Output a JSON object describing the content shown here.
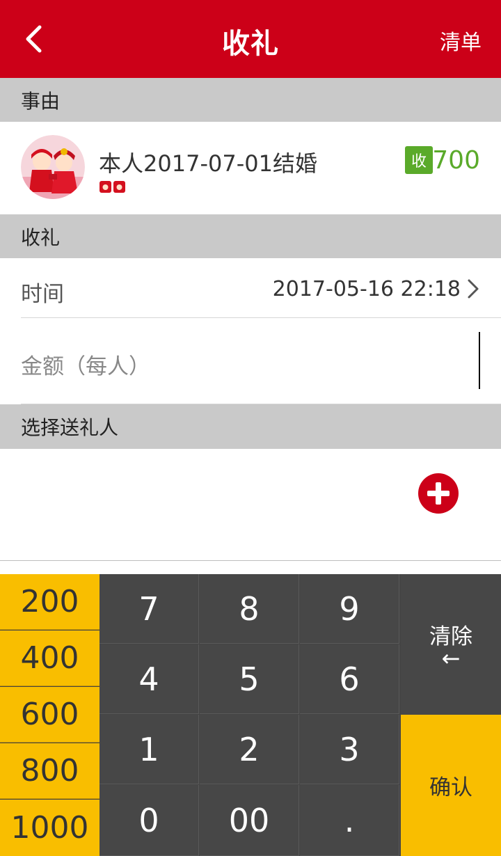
{
  "header": {
    "title": "收礼",
    "right_label": "清单",
    "back_icon": "chevron-left-icon"
  },
  "sections": {
    "reason": "事由",
    "receive": "收礼",
    "choose_giver": "选择送礼人"
  },
  "event": {
    "title": "本人2017-07-01结婚",
    "badge": "收",
    "amount": "700",
    "avatar_icon": "wedding-couple-avatar"
  },
  "form": {
    "time_label": "时间",
    "time_value": "2017-05-16 22:18",
    "amount_placeholder": "金额（每人）"
  },
  "keypad": {
    "presets": [
      "200",
      "400",
      "600",
      "800",
      "1000"
    ],
    "digits": [
      "7",
      "8",
      "9",
      "4",
      "5",
      "6",
      "1",
      "2",
      "3",
      "0",
      "00",
      "."
    ],
    "clear_label": "清除",
    "clear_arrow": "←",
    "confirm_label": "确认"
  },
  "colors": {
    "brand_red": "#cc0018",
    "green": "#5aaa2a",
    "yellow": "#f9be00",
    "keypad_gray": "#474747"
  }
}
